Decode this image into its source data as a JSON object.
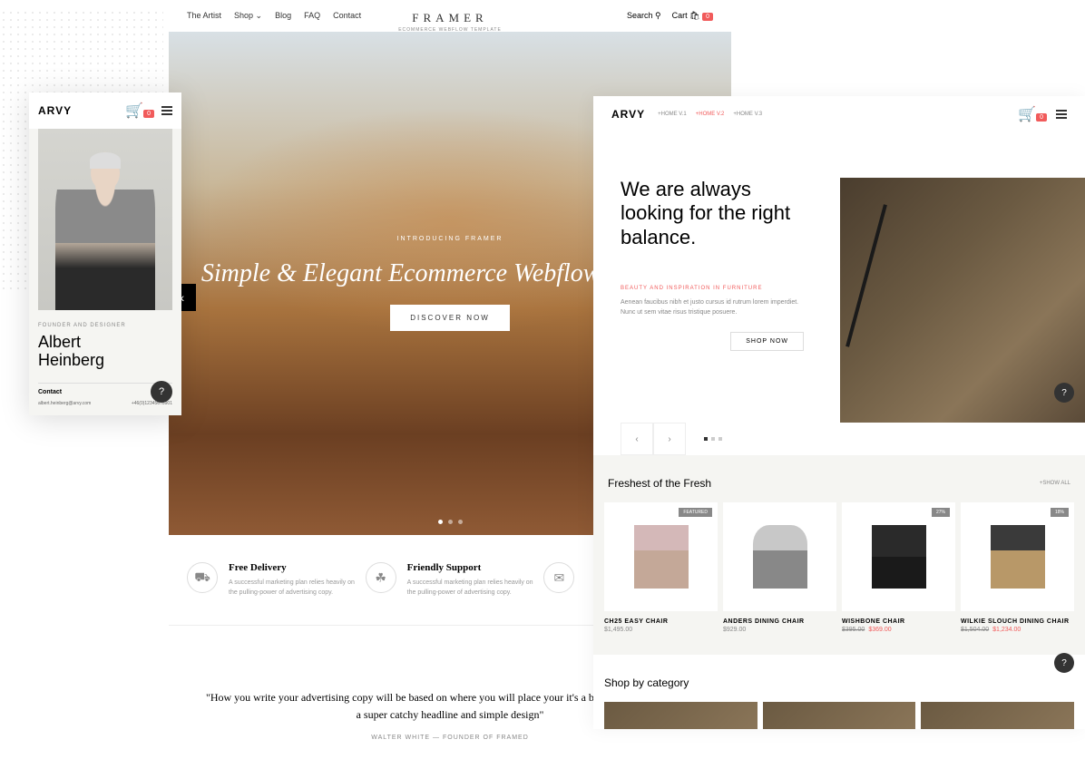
{
  "framer": {
    "nav": {
      "artist": "The Artist",
      "shop": "Shop",
      "blog": "Blog",
      "faq": "FAQ",
      "contact": "Contact",
      "logo_title": "FRAMER",
      "logo_sub": "ECOMMERCE WEBFLOW TEMPLATE",
      "search": "Search",
      "cart": "Cart",
      "cart_count": "0"
    },
    "hero": {
      "intro": "INTRODUCING FRAMER",
      "title": "Simple & Elegant Ecommerce Webflow Template",
      "cta": "DISCOVER NOW"
    },
    "features": {
      "f1_title": "Free Delivery",
      "f1_desc": "A successful marketing plan relies heavily on the pulling-power of advertising copy.",
      "f2_title": "Friendly Support",
      "f2_desc": "A successful marketing plan relies heavily on the pulling-power of advertising copy."
    },
    "quote": {
      "text": "\"How you write your advertising copy will be based on where you will place your it's a billboard ad, you'll need a super catchy headline and simple design\"",
      "author": "WALTER WHITE — FOUNDER OF FRAMED"
    }
  },
  "mobile": {
    "logo": "ARVY",
    "cart_count": "0",
    "role": "FOUNDER AND DESIGNER",
    "name_first": "Albert",
    "name_last": "Heinberg",
    "contact_label": "Contact",
    "email": "albert.heinberg@arvy.com",
    "phone": "+46(0)12345678901"
  },
  "arvy": {
    "logo": "ARVY",
    "nav1": "+HOME V.1",
    "nav2": "+HOME V.2",
    "nav3": "+HOME V.3",
    "cart_count": "0",
    "hero_title": "We are always looking for the right balance.",
    "hero_eyebrow": "BEAUTY AND INSPIRATION IN FURNITURE",
    "hero_desc": "Aenean faucibus nibh et justo cursus id rutrum lorem imperdiet. Nunc ut sem vitae risus tristique posuere.",
    "hero_cta": "SHOP NOW",
    "fresh_title": "Freshest of the Fresh",
    "show_all": "+SHOW ALL",
    "p1_badge": "FEATURED",
    "p1_name": "CH25 EASY CHAIR",
    "p1_price": "$1,495.00",
    "p2_name": "ANDERS DINING CHAIR",
    "p2_price": "$929.00",
    "p3_badge": "27%",
    "p3_name": "WISHBONE CHAIR",
    "p3_old": "$395.00",
    "p3_new": "$369.00",
    "p4_badge": "18%",
    "p4_name": "WILKIE SLOUCH DINING CHAIR",
    "p4_old": "$1,504.00",
    "p4_new": "$1,234.00",
    "cat_title": "Shop by category"
  }
}
